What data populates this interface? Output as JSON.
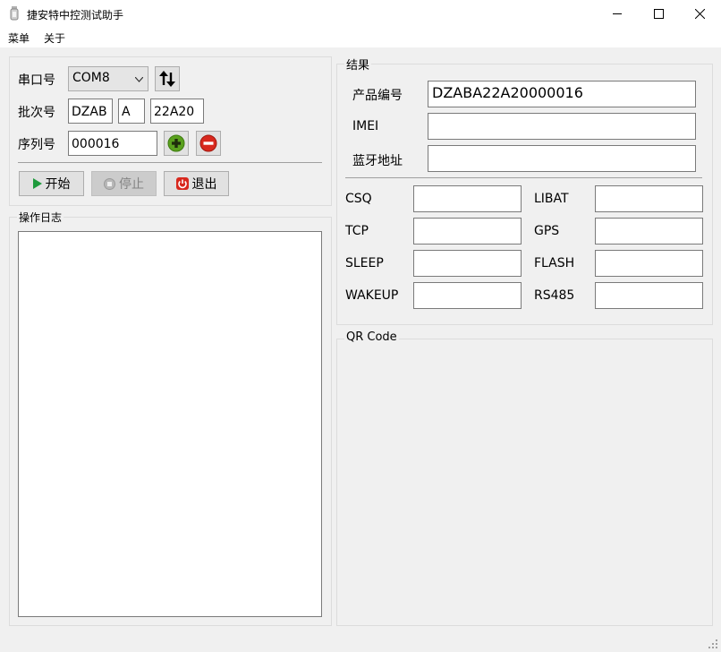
{
  "window": {
    "title": "捷安特中控测试助手"
  },
  "menu": {
    "items": [
      "菜单",
      "关于"
    ]
  },
  "serial": {
    "port_label": "串口号",
    "port_value": "COM8",
    "batch_label": "批次号",
    "batch_part1": "DZAB",
    "batch_part2": "A",
    "batch_part3": "22A20",
    "serial_label": "序列号",
    "serial_value": "000016"
  },
  "controls": {
    "start": "开始",
    "stop": "停止",
    "exit": "退出"
  },
  "log": {
    "title": "操作日志"
  },
  "result": {
    "title": "结果",
    "product_code_label": "产品编号",
    "product_code_value": "DZABA22A20000016",
    "imei_label": "IMEI",
    "imei_value": "",
    "bt_label": "蓝牙地址",
    "bt_value": "",
    "tests": [
      {
        "label": "CSQ",
        "value": ""
      },
      {
        "label": "LIBAT",
        "value": ""
      },
      {
        "label": "TCP",
        "value": ""
      },
      {
        "label": "GPS",
        "value": ""
      },
      {
        "label": "SLEEP",
        "value": ""
      },
      {
        "label": "FLASH",
        "value": ""
      },
      {
        "label": "WAKEUP",
        "value": ""
      },
      {
        "label": "RS485",
        "value": ""
      }
    ]
  },
  "qr": {
    "title": "QR Code"
  },
  "icons": [
    "app-icon",
    "minimize-icon",
    "maximize-icon",
    "close-icon",
    "chevron-down-icon",
    "swap-icon",
    "plus-icon",
    "minus-icon",
    "play-icon",
    "stop-icon",
    "power-icon"
  ],
  "colors": {
    "plus_green": "#5aa01e",
    "minus_red": "#d8281e",
    "power_red": "#d8281e",
    "play_green": "#1e9a3c"
  }
}
